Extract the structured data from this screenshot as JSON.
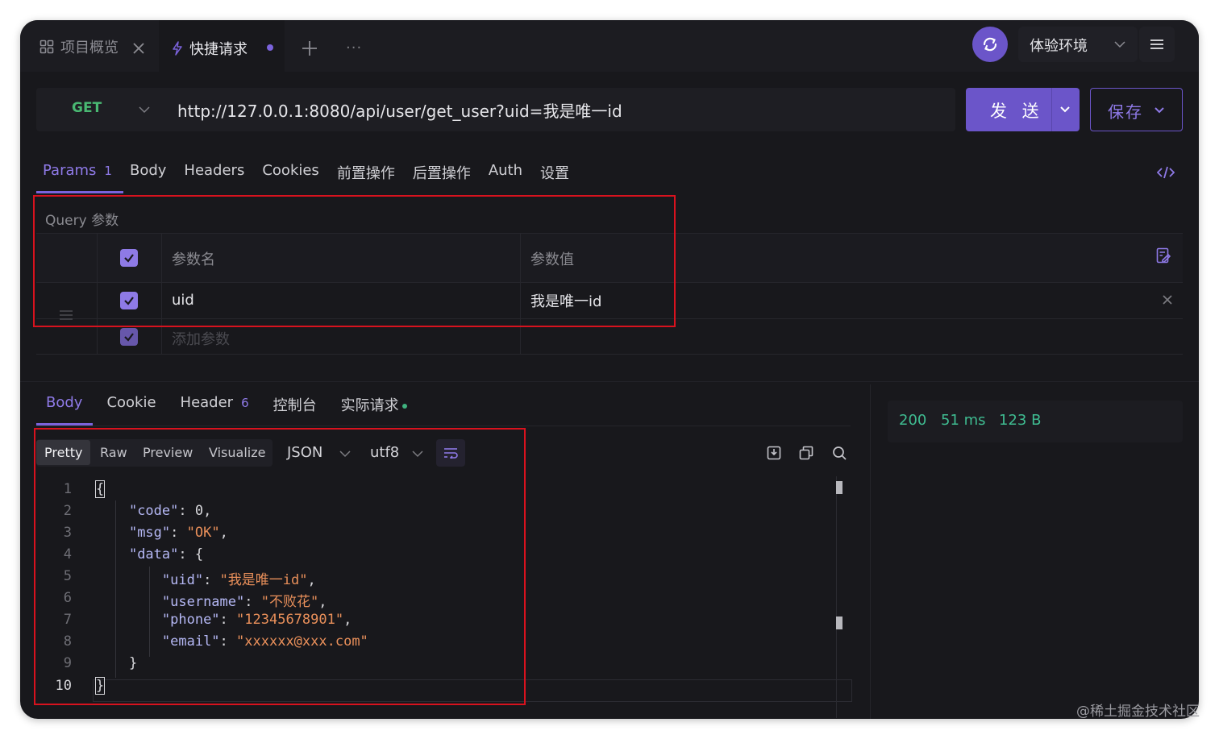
{
  "tabs": {
    "overview_label": "项目概览",
    "quick_label": "快捷请求",
    "more": "···"
  },
  "env": {
    "label": "体验环境"
  },
  "request": {
    "method": "GET",
    "url": "http://127.0.0.1:8080/api/user/get_user?uid=我是唯一id",
    "send_label": "发 送",
    "save_label": "保存"
  },
  "req_tabs": [
    {
      "label": "Params",
      "badge": "1"
    },
    {
      "label": "Body"
    },
    {
      "label": "Headers"
    },
    {
      "label": "Cookies"
    },
    {
      "label": "前置操作"
    },
    {
      "label": "后置操作"
    },
    {
      "label": "Auth"
    },
    {
      "label": "设置"
    }
  ],
  "query": {
    "title": "Query 参数",
    "col_name": "参数名",
    "col_value": "参数值",
    "rows": [
      {
        "name": "uid",
        "value": "我是唯一id"
      }
    ],
    "add_placeholder": "添加参数"
  },
  "resp_tabs": [
    {
      "label": "Body"
    },
    {
      "label": "Cookie"
    },
    {
      "label": "Header",
      "badge": "6"
    },
    {
      "label": "控制台"
    },
    {
      "label": "实际请求"
    }
  ],
  "status": {
    "code": "200",
    "time": "51 ms",
    "size": "123 B"
  },
  "format": {
    "modes": [
      "Pretty",
      "Raw",
      "Preview",
      "Visualize"
    ],
    "active_mode": "Pretty",
    "type": "JSON",
    "encoding": "utf8"
  },
  "editor": {
    "line_numbers": [
      "1",
      "2",
      "3",
      "4",
      "5",
      "6",
      "7",
      "8",
      "9",
      "10"
    ],
    "json": {
      "code_key": "\"code\"",
      "code_val": "0",
      "msg_key": "\"msg\"",
      "msg_val": "\"OK\"",
      "data_key": "\"data\"",
      "uid_key": "\"uid\"",
      "uid_val": "\"我是唯一id\"",
      "username_key": "\"username\"",
      "username_val": "\"不败花\"",
      "phone_key": "\"phone\"",
      "phone_val": "\"12345678901\"",
      "email_key": "\"email\"",
      "email_val": "\"xxxxxx@xxx.com\""
    }
  },
  "watermark": "@稀土掘金技术社区",
  "colors": {
    "accent": "#6b55c9",
    "status": "#3fbc91",
    "method": "#49b872"
  }
}
